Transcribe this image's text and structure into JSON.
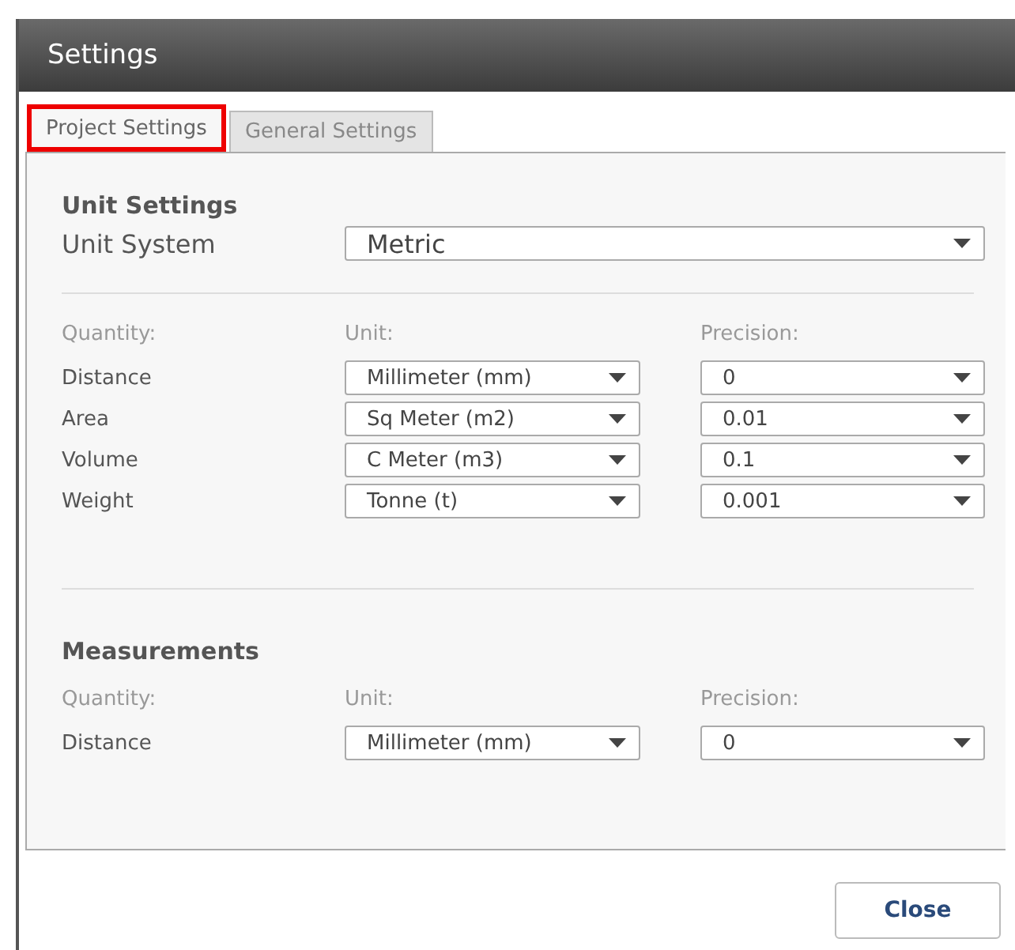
{
  "window": {
    "title": "Settings"
  },
  "tabs": [
    {
      "label": "Project Settings",
      "selected": true
    },
    {
      "label": "General Settings",
      "selected": false
    }
  ],
  "unit_settings": {
    "heading": "Unit Settings",
    "unit_system_label": "Unit System",
    "unit_system": "Metric",
    "columns": [
      "Quantity:",
      "Unit:",
      "Precision:"
    ],
    "rows": [
      {
        "quantity": "Distance",
        "unit": "Millimeter (mm)",
        "precision": "0"
      },
      {
        "quantity": "Area",
        "unit": "Sq Meter (m2)",
        "precision": "0.01"
      },
      {
        "quantity": "Volume",
        "unit": "C Meter (m3)",
        "precision": "0.1"
      },
      {
        "quantity": "Weight",
        "unit": "Tonne (t)",
        "precision": "0.001"
      }
    ]
  },
  "measurements": {
    "heading": "Measurements",
    "columns": [
      "Quantity:",
      "Unit:",
      "Precision:"
    ],
    "rows": [
      {
        "quantity": "Distance",
        "unit": "Millimeter (mm)",
        "precision": "0"
      }
    ]
  },
  "buttons": [
    "Close"
  ]
}
